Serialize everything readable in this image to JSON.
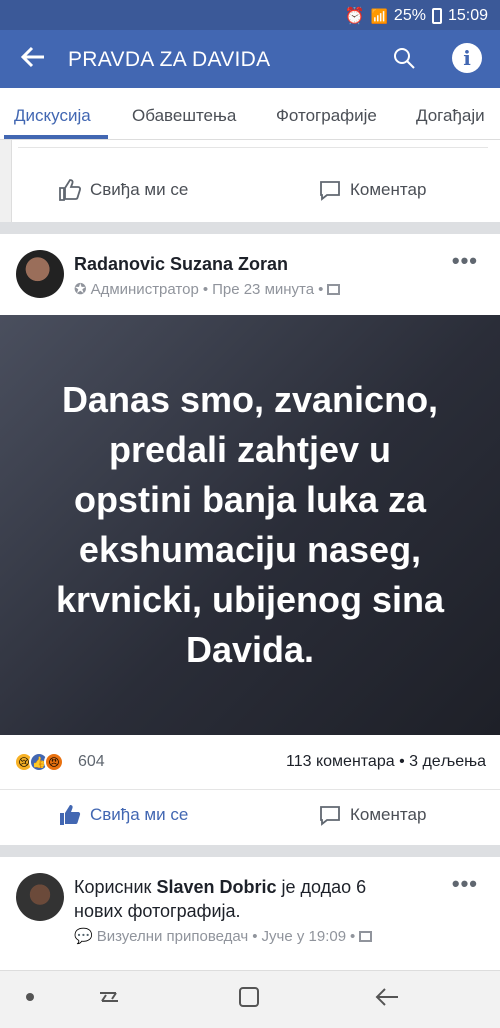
{
  "status_bar": {
    "battery": "25%",
    "time": "15:09"
  },
  "app_bar": {
    "title": "PRAVDA ZA DAVIDA"
  },
  "tabs": [
    {
      "label": "Дискусија",
      "active": true
    },
    {
      "label": "Обавештења",
      "active": false
    },
    {
      "label": "Фотографије",
      "active": false
    },
    {
      "label": "Догађаји",
      "active": false
    }
  ],
  "prev_post": {
    "like_label": "Свиђа ми се",
    "comment_label": "Коментар"
  },
  "post": {
    "author": "Radanovic Suzana Zoran",
    "role": "Администратор",
    "time": "Пре 23 минута",
    "dot": "•",
    "text": "Danas smo, zvanicno,\npredali zahtjev u\nopstini banja luka  za\nekshumaciju naseg,\nkrvnicki, ubijenog sina\nDavida.",
    "reaction_count": "604",
    "comments_shares": "113 коментара • 3 дељења",
    "like_label": "Свиђа ми се",
    "comment_label": "Коментар"
  },
  "next_post": {
    "prefix": "Корисник",
    "user": "Slaven Dobric",
    "suffix": "је додао 6",
    "line2": "нових фотографија.",
    "role": "Визуелни приповедач",
    "time": "Јуче у 19:09",
    "dot": "•"
  },
  "colors": {
    "brand": "#4267b2",
    "status": "#3b5998"
  }
}
